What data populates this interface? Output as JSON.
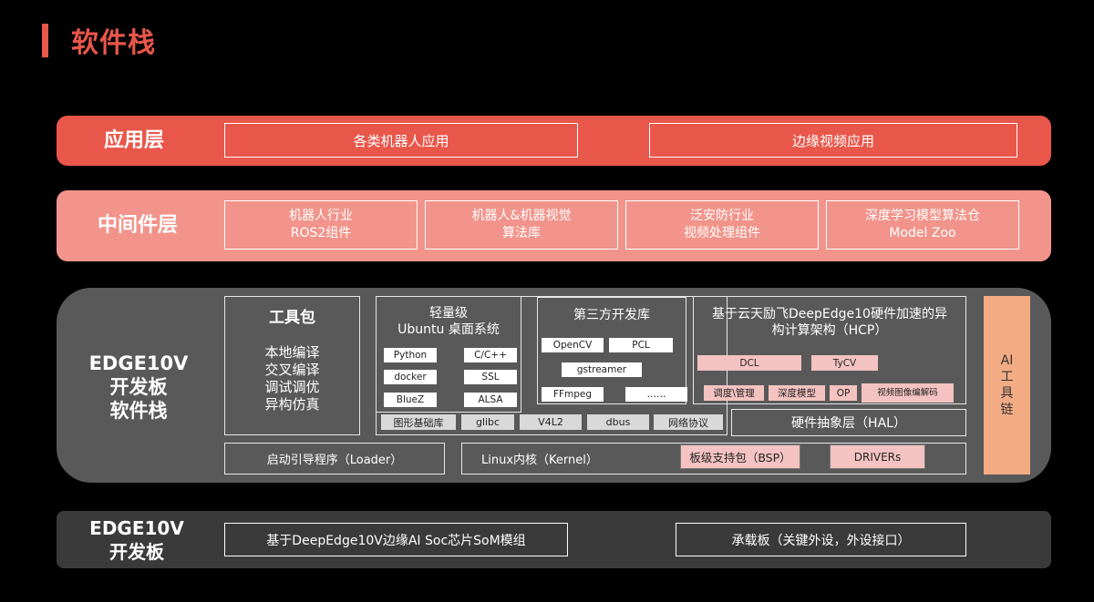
{
  "page": {
    "title": "软件栈"
  },
  "accent_colors": {
    "red": "#e8574a",
    "salmon": "#f2948b",
    "dark_grey": "#595959",
    "peach": "#f3ab84"
  },
  "app_layer": {
    "label": "应用层",
    "items": [
      "各类机器人应用",
      "边缘视频应用"
    ]
  },
  "middleware_layer": {
    "label": "中间件层",
    "items": [
      {
        "line1": "机器人行业",
        "line2": "ROS2组件"
      },
      {
        "line1": "机器人&机器视觉",
        "line2": "算法库"
      },
      {
        "line1": "泛安防行业",
        "line2": "视频处理组件"
      },
      {
        "line1": "深度学习模型算法仓",
        "line2": "Model Zoo"
      }
    ]
  },
  "edge_layer": {
    "label_line1": "EDGE10V",
    "label_line2": "开发板",
    "label_line3": "软件栈",
    "toolkit": {
      "title": "工具包",
      "items": [
        "本地编译",
        "交叉编译",
        "调试调优",
        "异构仿真"
      ]
    },
    "ubuntu": {
      "title_line1": "轻量级",
      "title_line2": "Ubuntu 桌面系统",
      "chips": [
        "Python",
        "C/C++",
        "docker",
        "SSL",
        "BlueZ",
        "ALSA"
      ]
    },
    "thirdparty": {
      "title": "第三方开发库",
      "chips": [
        "OpenCV",
        "PCL",
        "gstreamer",
        "FFmpeg",
        "……"
      ]
    },
    "hcp": {
      "title_line1": "基于云天励飞DeepEdge10硬件加速的异",
      "title_line2": "构计算架构（HCP）",
      "chips_row1": [
        "DCL",
        "TyCV"
      ],
      "chips_row2": [
        "调度\\管理",
        "深度模型",
        "OP",
        "视频图像编解码"
      ]
    },
    "bottom_row": [
      "图形基础库",
      "glibc",
      "V4L2",
      "dbus",
      "网络协议"
    ],
    "hal": "硬件抽象层（HAL）",
    "loader": "启动引导程序（Loader）",
    "kernel": "Linux内核（Kernel）",
    "bsp": "板级支持包（BSP）",
    "drivers": "DRIVERs",
    "ai_toolchain": [
      "AI",
      "工",
      "具",
      "链"
    ]
  },
  "board_layer": {
    "label_line1": "EDGE10V",
    "label_line2": "开发板",
    "items": [
      "基于DeepEdge10V边缘AI Soc芯片SoM模组",
      "承载板（关键外设，外设接口）"
    ]
  }
}
